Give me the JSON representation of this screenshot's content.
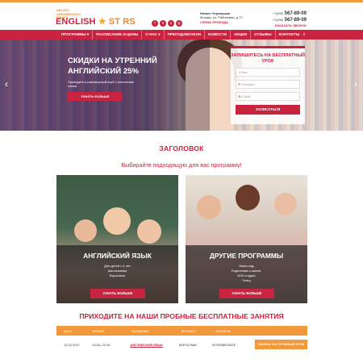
{
  "logo": {
    "small": "ШКОЛА АНГЛИЙСКОГО ЯЗЫКА",
    "english": "ENGLISH",
    "stars": "ST RS"
  },
  "socials": [
    "f",
    "vk",
    "ok",
    "ig"
  ],
  "address": {
    "station": "Новые Черемушки",
    "street": "Москва, ул. Рябиновая, д.72",
    "scheme": "СХЕМА ПРОЕЗДА"
  },
  "phones": {
    "prefix1": "+7(495)",
    "number1": "567-89-09",
    "prefix2": "+7(495)",
    "number2": "567-89-09",
    "callback": "ЗАКАЗАТЬ ЗВОНОК"
  },
  "nav": {
    "items": [
      "ПРОГРАММЫ ▾",
      "РАСПИСАНИЕ И ЦЕНЫ",
      "О НАС ▾",
      "ПРЕПОДАВАТЕЛИ",
      "НОВОСТИ",
      "АКЦИИ",
      "ОТЗЫВЫ",
      "КОНТАКТЫ"
    ],
    "search_icon": "search-icon"
  },
  "hero": {
    "title": "СКИДКИ НА УТРЕННИЙ АНГЛИЙСКИЙ 25%",
    "subtitle": "Приходите в разговорный клуб с носителем языка",
    "button": "УЗНАТЬ БОЛЬШЕ",
    "prev": "‹",
    "next": "›"
  },
  "form": {
    "title": "ЗАПИШИТЕСЬ НА БЕСПЛАТНЫЙ УРОК",
    "name_placeholder": "Имя",
    "phone_placeholder": "Телефон",
    "email_placeholder": "E-Mail",
    "submit": "ЗАПИСАТЬСЯ"
  },
  "heading": "ЗАГОЛОВОК",
  "choose": "Выбирайте подходящую для вас программу!",
  "cards": [
    {
      "title": "АНГЛИЙСКИЙ ЯЗЫК",
      "lines": [
        "Для детей с 4 лет",
        "Школьникам",
        "Взрослым"
      ],
      "button": "УЗНАТЬ БОЛЬШЕ"
    },
    {
      "title": "ДРУГИЕ ПРОГРАММЫ",
      "lines": [
        "Мини-сад",
        "Подготовка к школе,",
        "ИЗО-студия",
        "Театр"
      ],
      "button": "УЗНАТЬ БОЛЬШЕ"
    }
  ],
  "trial_heading": "ПРИХОДИТЕ НА НАШИ ПРОБНЫЕ БЕСПЛАТНЫЕ ЗАНЯТИЯ",
  "table": {
    "headers": [
      "ДАТА",
      "ВРЕМЯ",
      "НАЗВАНИЕ",
      "ВОЗРАСТ",
      "УРОВЕНЬ"
    ],
    "rows": [
      {
        "date": "12.02.2017",
        "time": "19:00–21:00",
        "name": "АНГЛИЙСКИЙ ЯЗЫК",
        "age": "ВЗРОСЛЫЕ",
        "level": "INTERMEDIATE",
        "button": "ЗАПИСЬ НА ПРОБНЫЙ УРОК"
      }
    ]
  },
  "colors": {
    "brand": "#c8243f",
    "accent": "#f0983a"
  }
}
